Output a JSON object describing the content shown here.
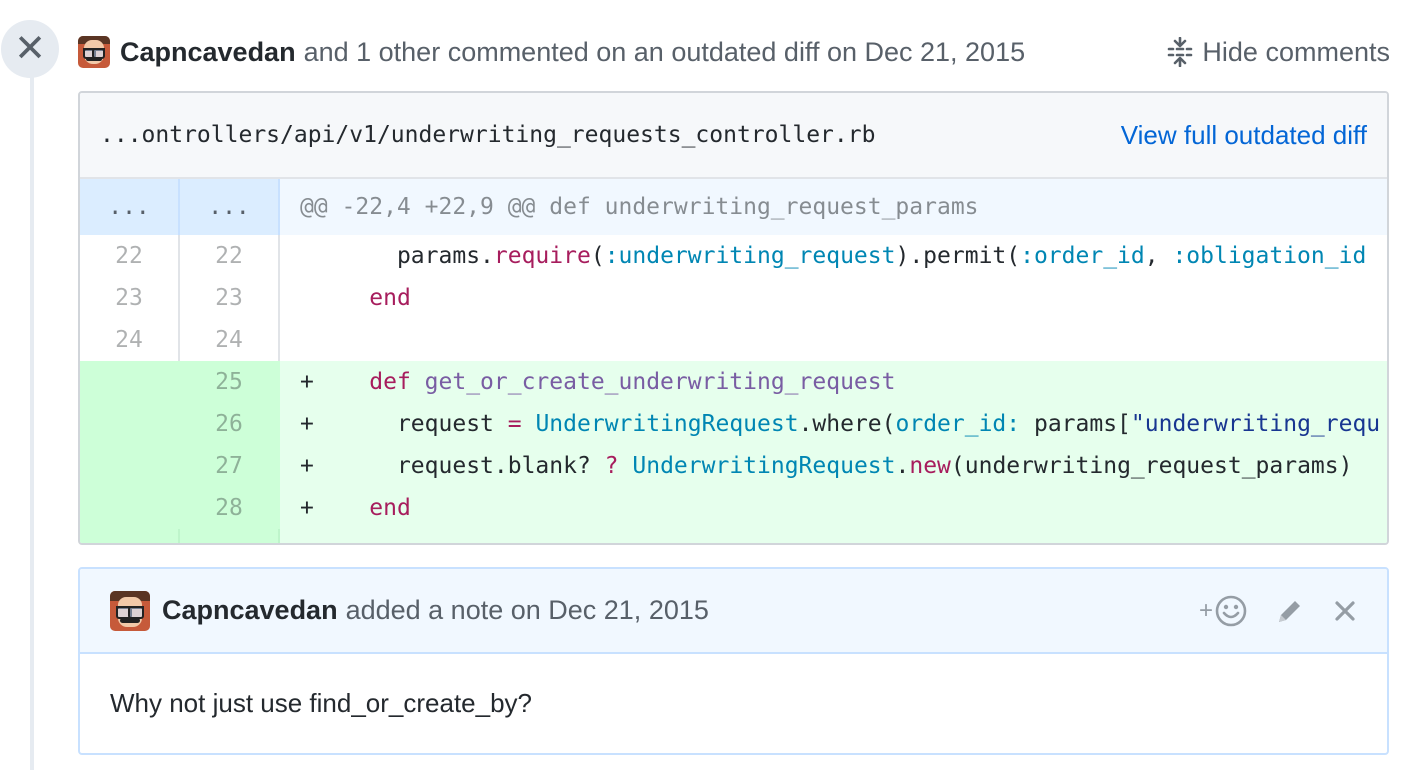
{
  "discussion": {
    "author": "Capncavedan",
    "summary": "and 1 other commented on an outdated diff on Dec 21, 2015",
    "hide_comments_label": "Hide comments",
    "close_symbol": "✕"
  },
  "file": {
    "path": "...ontrollers/api/v1/underwriting_requests_controller.rb",
    "view_full_label": "View full outdated diff",
    "hunk": {
      "old": "...",
      "new": "...",
      "text": "@@ -22,4 +22,9 @@ def underwriting_request_params"
    },
    "lines": [
      {
        "old": "22",
        "new": "22",
        "marker": " "
      },
      {
        "old": "23",
        "new": "23",
        "marker": " "
      },
      {
        "old": "24",
        "new": "24",
        "marker": " "
      },
      {
        "old": "",
        "new": "25",
        "marker": "+"
      },
      {
        "old": "",
        "new": "26",
        "marker": "+"
      },
      {
        "old": "",
        "new": "27",
        "marker": "+"
      },
      {
        "old": "",
        "new": "28",
        "marker": "+"
      }
    ],
    "code": {
      "l22": {
        "indent": "      ",
        "a": "params.",
        "b": "require",
        "c": "(",
        "d": ":underwriting_request",
        "e": ").permit(",
        "f": ":order_id",
        "g": ", ",
        "h": ":obligation_id"
      },
      "l23": {
        "indent": "    ",
        "kw": "end"
      },
      "l25": {
        "indent": "    ",
        "kw": "def",
        "sp": " ",
        "fn": "get_or_create_underwriting_request"
      },
      "l26": {
        "indent": "      ",
        "a": "request ",
        "op": "=",
        "sp": " ",
        "cls": "UnderwritingRequest",
        "b": ".where(",
        "sym": "order_id:",
        "c": " params[",
        "str": "\"underwriting_requ"
      },
      "l27": {
        "indent": "      ",
        "a": "request.blank? ",
        "op": "?",
        "sp": " ",
        "cls": "UnderwritingRequest",
        "dot": ".",
        "kw": "new",
        "b": "(underwriting_request_params)"
      },
      "l28": {
        "indent": "    ",
        "kw": "end"
      }
    },
    "colors": {
      "addition_bg": "#e6ffed",
      "hunk_bg": "#f1f8ff",
      "keyword": "#a71d5d",
      "link": "#0366d6"
    }
  },
  "comment": {
    "author": "Capncavedan",
    "meta": "added a note on Dec 21, 2015",
    "body": "Why not just use find_or_create_by?",
    "reaction_plus": "+",
    "actions": [
      "add-reaction",
      "edit",
      "delete"
    ]
  }
}
